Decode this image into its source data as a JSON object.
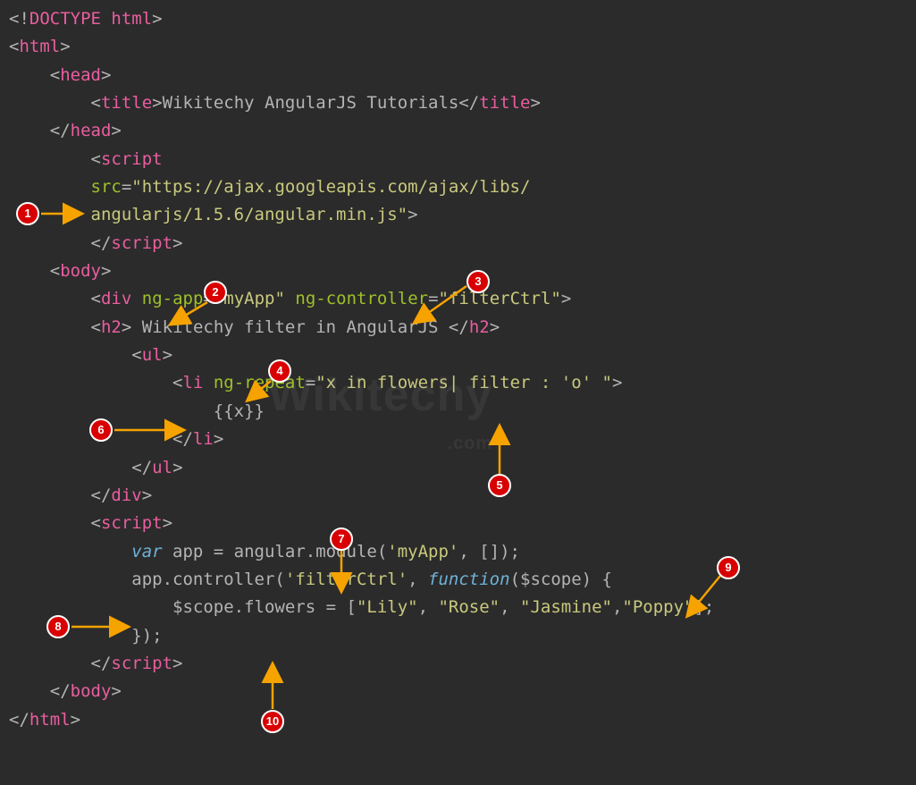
{
  "code": {
    "l1_doctype": "DOCTYPE html",
    "l2_open_html": "html",
    "l3_open_head": "head",
    "l4_open_title": "title",
    "l4_title_text": "Wikitechy AngularJS Tutorials",
    "l4_close_title": "title",
    "l5_close_head": "head",
    "l6_open_script": "script",
    "l7_src_attr": "src",
    "l7_src_val": "\"https://ajax.googleapis.com/ajax/libs/",
    "l8_src_cont": "angularjs/1.5.6/angular.min.js\"",
    "l9_close_script": "script",
    "l10_open_body": "body",
    "l11_div": "div",
    "l11_ngapp": "ng-app",
    "l11_ngapp_v": "\"myApp\"",
    "l11_ngctrl": "ng-controller",
    "l11_ngctrl_v": "\"filterCtrl\"",
    "l12_h2": "h2",
    "l12_h2_text": " Wikitechy filter in AngularJS ",
    "l13_ul": "ul",
    "l14_li": "li",
    "l14_ngrepeat": "ng-repeat",
    "l14_ngrepeat_v": "\"x in flowers| filter : 'o' \"",
    "l15_expr": "{{x}}",
    "l16_close_li": "li",
    "l17_close_ul": "ul",
    "l18_close_div": "div",
    "l19_open_script2": "script",
    "l20_var": "var",
    "l20_rest": " app = angular.module(",
    "l20_str": "'myApp'",
    "l20_rest2": ", []);",
    "l21_app": "app.controller(",
    "l21_str": "'filterCtrl'",
    "l21_sep": ", ",
    "l21_fn": "function",
    "l21_rest": "($scope) {",
    "l22_scope": "$scope.flowers = [",
    "l22_s1": "\"Lily\"",
    "l22_s2": "\"Rose\"",
    "l22_s3": "\"Jasmine\"",
    "l22_s4": "\"Poppy\"",
    "l22_end": "];",
    "l23_close": "});",
    "l24_close_script2": "script",
    "l25_close_body": "body",
    "l26_close_html": "html"
  },
  "badges": {
    "b1": "1",
    "b2": "2",
    "b3": "3",
    "b4": "4",
    "b5": "5",
    "b6": "6",
    "b7": "7",
    "b8": "8",
    "b9": "9",
    "b10": "10"
  },
  "watermark": {
    "main": "Wikitechy",
    "sub": ".com"
  }
}
